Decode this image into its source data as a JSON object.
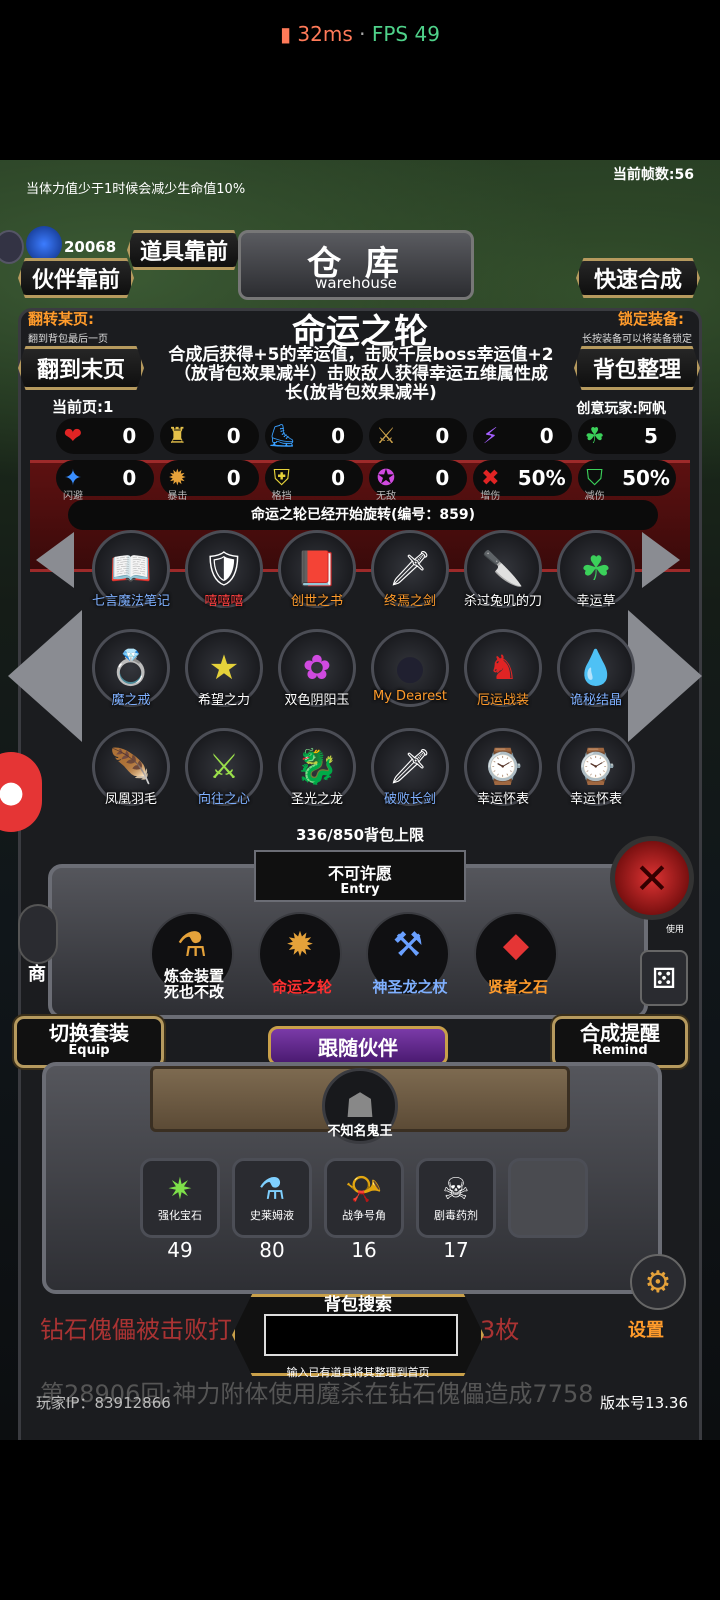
{
  "status": {
    "ping": "32ms",
    "fps_text": "FPS 49",
    "separator": "·"
  },
  "top": {
    "hint": "当体力值少于1时候会减少生命值10%",
    "frame_count": "当前帧数:56",
    "gem_count": "20068"
  },
  "buttons": {
    "partner_front": "伙伴靠前",
    "item_front": "道具靠前",
    "quick_merge": "快速合成",
    "to_last_page": "翻到末页",
    "organize_bag": "背包整理",
    "switch_set": "切换套装",
    "switch_set_sub": "Equip",
    "merge_remind": "合成提醒",
    "merge_remind_sub": "Remind"
  },
  "warehouse": {
    "title": "仓 库",
    "subtitle": "warehouse"
  },
  "page_jump": {
    "title": "翻转某页:",
    "sub": "翻到背包最后一页"
  },
  "lock_equip": {
    "title": "锁定装备:",
    "sub": "长按装备可以将装备锁定"
  },
  "selected_item": {
    "name": "命运之轮",
    "description": "合成后获得+5的幸运值，击败千层boss幸运值+2（放背包效果减半）击败敌人获得幸运五维属性成长(放背包效果减半)"
  },
  "current_page": "当前页:1",
  "creator": "创意玩家:阿帆",
  "stats": [
    {
      "icon": "heart-icon",
      "glyph": "❤",
      "color": "#e02424",
      "value": "0",
      "label": ""
    },
    {
      "icon": "armor-icon",
      "glyph": "♜",
      "color": "#e5c14a",
      "value": "0",
      "label": ""
    },
    {
      "icon": "boots-icon",
      "glyph": "⛸",
      "color": "#3aa0ff",
      "value": "0",
      "label": ""
    },
    {
      "icon": "sword-icon",
      "glyph": "⚔",
      "color": "#c9a04a",
      "value": "0",
      "label": ""
    },
    {
      "icon": "lightning-icon",
      "glyph": "⚡",
      "color": "#a560ff",
      "value": "0",
      "label": ""
    },
    {
      "icon": "clover-icon",
      "glyph": "☘",
      "color": "#3bd05a",
      "value": "5",
      "label": ""
    },
    {
      "icon": "dodge-icon",
      "glyph": "✦",
      "color": "#3a8fff",
      "value": "0",
      "label": "闪避"
    },
    {
      "icon": "crit-icon",
      "glyph": "✹",
      "color": "#e6a23a",
      "value": "0",
      "label": "暴击"
    },
    {
      "icon": "block-icon",
      "glyph": "⛨",
      "color": "#e6d23a",
      "value": "0",
      "label": "格挡"
    },
    {
      "icon": "invincible-icon",
      "glyph": "✪",
      "color": "#d04ae0",
      "value": "0",
      "label": "无敌"
    },
    {
      "icon": "damage-up-icon",
      "glyph": "✖",
      "color": "#e02424",
      "value": "50%",
      "label": "增伤"
    },
    {
      "icon": "damage-down-icon",
      "glyph": "⛉",
      "color": "#3bd05a",
      "value": "50%",
      "label": "减伤"
    }
  ],
  "wheel_msg": "命运之轮已经开始旋转(编号：859)",
  "items": [
    {
      "name": "七言魔法笔记",
      "color": "#7fb0ff",
      "glyph": "📖"
    },
    {
      "name": "嘻嘻嘻",
      "color": "#ff4040",
      "glyph": "🛡"
    },
    {
      "name": "创世之书",
      "color": "#ff9b2b",
      "glyph": "📕"
    },
    {
      "name": "终焉之剑",
      "color": "#ff9b2b",
      "glyph": "🗡"
    },
    {
      "name": "杀过兔叽的刀",
      "color": "#ffffff",
      "glyph": "🔪"
    },
    {
      "name": "幸运草",
      "color": "#ffffff",
      "glyph": "☘"
    },
    {
      "name": "魔之戒",
      "color": "#7fb0ff",
      "glyph": "💍"
    },
    {
      "name": "希望之力",
      "color": "#ffffff",
      "glyph": "★"
    },
    {
      "name": "双色阴阳玉",
      "color": "#ffffff",
      "glyph": "✿"
    },
    {
      "name": "My Dearest",
      "color": "#ff9b2b",
      "glyph": "●"
    },
    {
      "name": "厄运战装",
      "color": "#ff9b2b",
      "glyph": "♞"
    },
    {
      "name": "诡秘结晶",
      "color": "#7fb0ff",
      "glyph": "💧"
    },
    {
      "name": "凤凰羽毛",
      "color": "#ffffff",
      "glyph": "🪶"
    },
    {
      "name": "向往之心",
      "color": "#7fb0ff",
      "glyph": "⚔"
    },
    {
      "name": "圣光之龙",
      "color": "#ffffff",
      "glyph": "🐉"
    },
    {
      "name": "破败长剑",
      "color": "#7fb0ff",
      "glyph": "🗡"
    },
    {
      "name": "幸运怀表",
      "color": "#ffffff",
      "glyph": "⌚"
    },
    {
      "name": "幸运怀表",
      "color": "#ffffff",
      "glyph": "⌚"
    }
  ],
  "bag_limit": "336/850背包上限",
  "entry": {
    "title": "不可许愿",
    "sub": "Entry"
  },
  "entry_items": [
    {
      "name_line1": "炼金装置",
      "name_line2": "死也不改",
      "color": "#ffffff",
      "glyph": "⚗"
    },
    {
      "name_line1": "命运之轮",
      "name_line2": "",
      "color": "#ff3030",
      "glyph": "✹"
    },
    {
      "name_line1": "神圣龙之杖",
      "name_line2": "",
      "color": "#7fb0ff",
      "glyph": "⚒"
    },
    {
      "name_line1": "贤者之石",
      "name_line2": "",
      "color": "#ff9b2b",
      "glyph": "◆"
    }
  ],
  "follow": {
    "title": "跟随伙伴",
    "partner_name": "不知名鬼王"
  },
  "bag_items": [
    {
      "name": "强化宝石",
      "count": "49",
      "glyph": "✷",
      "color": "#7ee04a"
    },
    {
      "name": "史莱姆液",
      "count": "80",
      "glyph": "⚗",
      "color": "#7fd0ff"
    },
    {
      "name": "战争号角",
      "count": "16",
      "glyph": "📯",
      "color": "#ddd"
    },
    {
      "name": "剧毒药剂",
      "count": "17",
      "glyph": "☠",
      "color": "#ddd"
    },
    {
      "name": "",
      "count": "",
      "glyph": "",
      "color": "#ddd"
    }
  ],
  "bottom": {
    "scroll_msg": "钻石傀儡被击败打",
    "scroll_msg2": "3枚",
    "search_title": "背包搜索",
    "search_placeholder": "",
    "search_hint": "输入已有道具将其整理到首页",
    "ticker": "第28906回:神力附体使用魔杀在钻石傀儡造成7758",
    "player_ip": "玩家IP：83912866",
    "version": "版本号13.36",
    "settings": "设置",
    "shop": "商",
    "use_label": "使用"
  }
}
